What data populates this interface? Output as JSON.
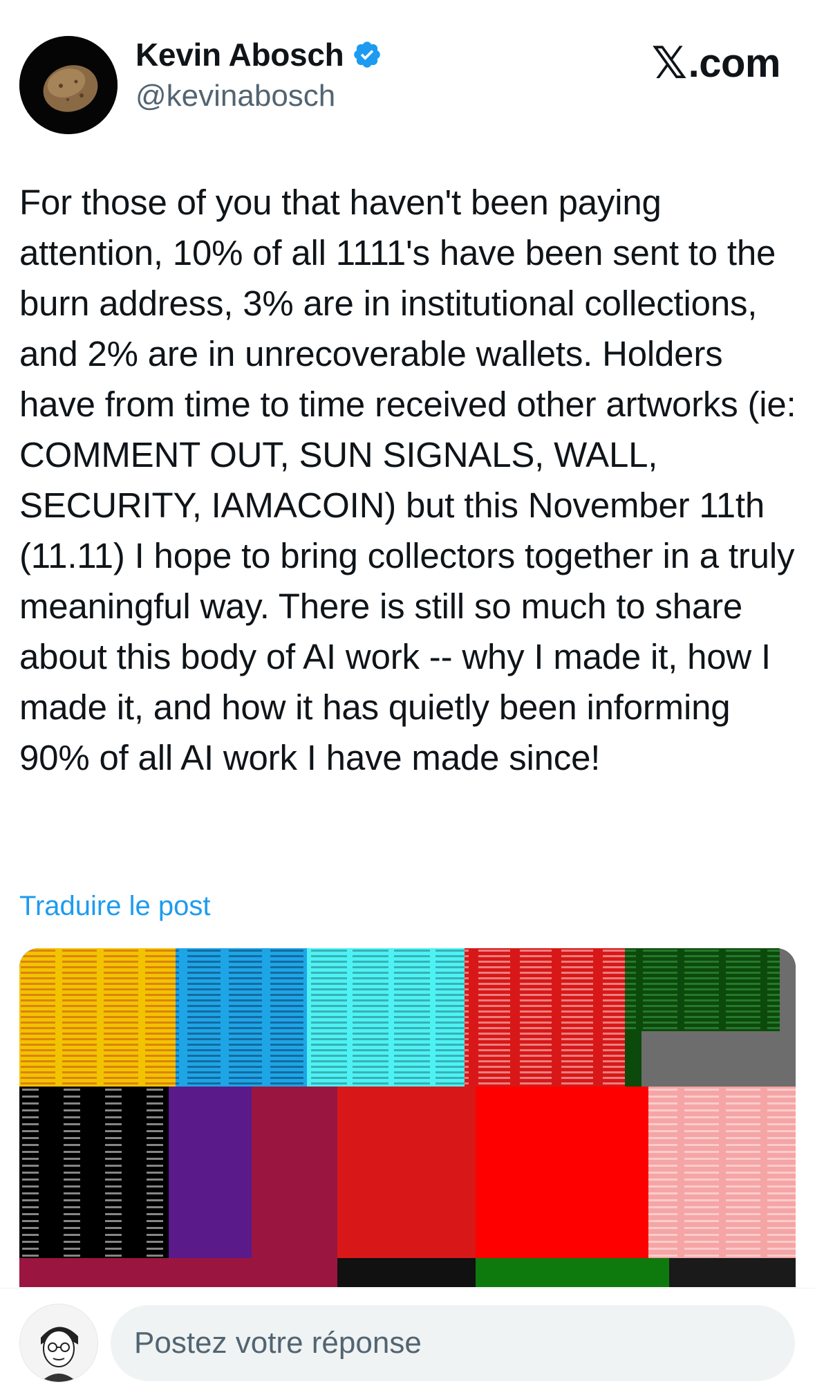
{
  "header": {
    "author_name": "Kevin Abosch",
    "author_handle": "@kevinabosch",
    "verified_icon": "verified-badge-icon",
    "site_logo_mark": "𝕏",
    "site_logo_text": ".com"
  },
  "post": {
    "text": "For those of you that haven't been paying attention, 10% of all 1111's have been sent to the burn address, 3% are in institutional collections, and 2% are in unrecoverable wallets. Holders have from time to time received other artworks (ie: COMMENT OUT, SUN SIGNALS, WALL, SECURITY, IAMACOIN) but this November 11th (11.11) I hope to bring collectors together in a truly meaningful way. There is still so much to share about this body of AI work -- why I made it, how I made it, and how it has quietly been informing 90% of all AI work I have made since!",
    "translate_label": "Traduire le post"
  },
  "media": {
    "description_icon": "colored-hex-grid-artwork",
    "colors": {
      "yellow": "#f2c300",
      "blue": "#1ea5e6",
      "cyan": "#4ef2f2",
      "red": "#d81818",
      "green": "#0c4a0c",
      "gray": "#6d6d6d",
      "black": "#000000",
      "purple": "#5a1a8a",
      "magenta": "#9a1540",
      "bright_red": "#ff0000",
      "pink": "#f5a5a5"
    }
  },
  "reply": {
    "placeholder": "Postez votre réponse"
  },
  "colors": {
    "link": "#1d9bf0",
    "secondary_text": "#536471",
    "primary_text": "#0f1419",
    "verified": "#1d9bf0"
  }
}
